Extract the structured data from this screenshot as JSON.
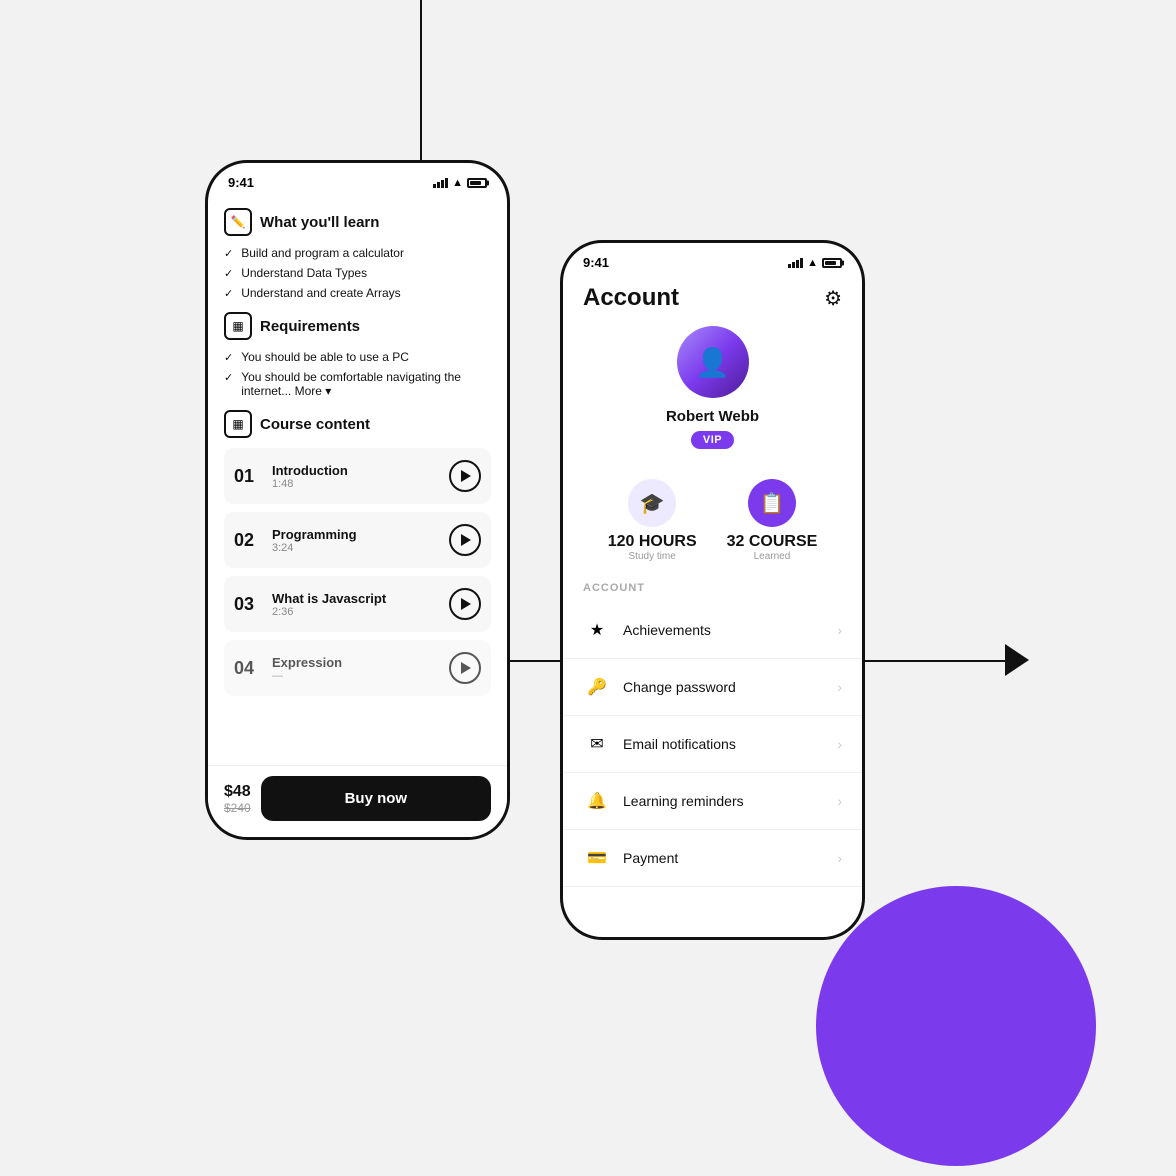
{
  "decorative": {
    "purple_circle": true,
    "arrow_label": "arrow-right"
  },
  "phone1": {
    "status_time": "9:41",
    "sections": {
      "what_you_learn": {
        "title": "What you'll learn",
        "items": [
          "Build and program a calculator",
          "Understand Data Types",
          "Understand and create Arrays"
        ]
      },
      "requirements": {
        "title": "Requirements",
        "items": [
          "You should be able to use a PC",
          "You should be comfortable navigating the internet..."
        ],
        "more": "More"
      },
      "course_content": {
        "title": "Course content",
        "lessons": [
          {
            "number": "01",
            "name": "Introduction",
            "duration": "1:48"
          },
          {
            "number": "02",
            "name": "Programming",
            "duration": "3:24"
          },
          {
            "number": "03",
            "name": "What is Javascript",
            "duration": "2:36"
          },
          {
            "number": "04",
            "name": "Expression",
            "duration": "..."
          }
        ]
      }
    },
    "buy": {
      "price_current": "$48",
      "price_original": "$240",
      "button_label": "Buy now"
    }
  },
  "phone2": {
    "status_time": "9:41",
    "title": "Account",
    "profile": {
      "name": "Robert Webb",
      "badge": "VIP"
    },
    "stats": [
      {
        "value": "120 HOURS",
        "label": "Study time",
        "icon": "🎓",
        "style": "light"
      },
      {
        "value": "32 COURSE",
        "label": "Learned",
        "icon": "📋",
        "style": "dark"
      }
    ],
    "section_label": "ACCOUNT",
    "menu_items": [
      {
        "icon": "★",
        "label": "Achievements"
      },
      {
        "icon": "🔑",
        "label": "Change password"
      },
      {
        "icon": "✉",
        "label": "Email notifications"
      },
      {
        "icon": "🔔",
        "label": "Learning reminders"
      },
      {
        "icon": "💳",
        "label": "Payment"
      }
    ]
  }
}
